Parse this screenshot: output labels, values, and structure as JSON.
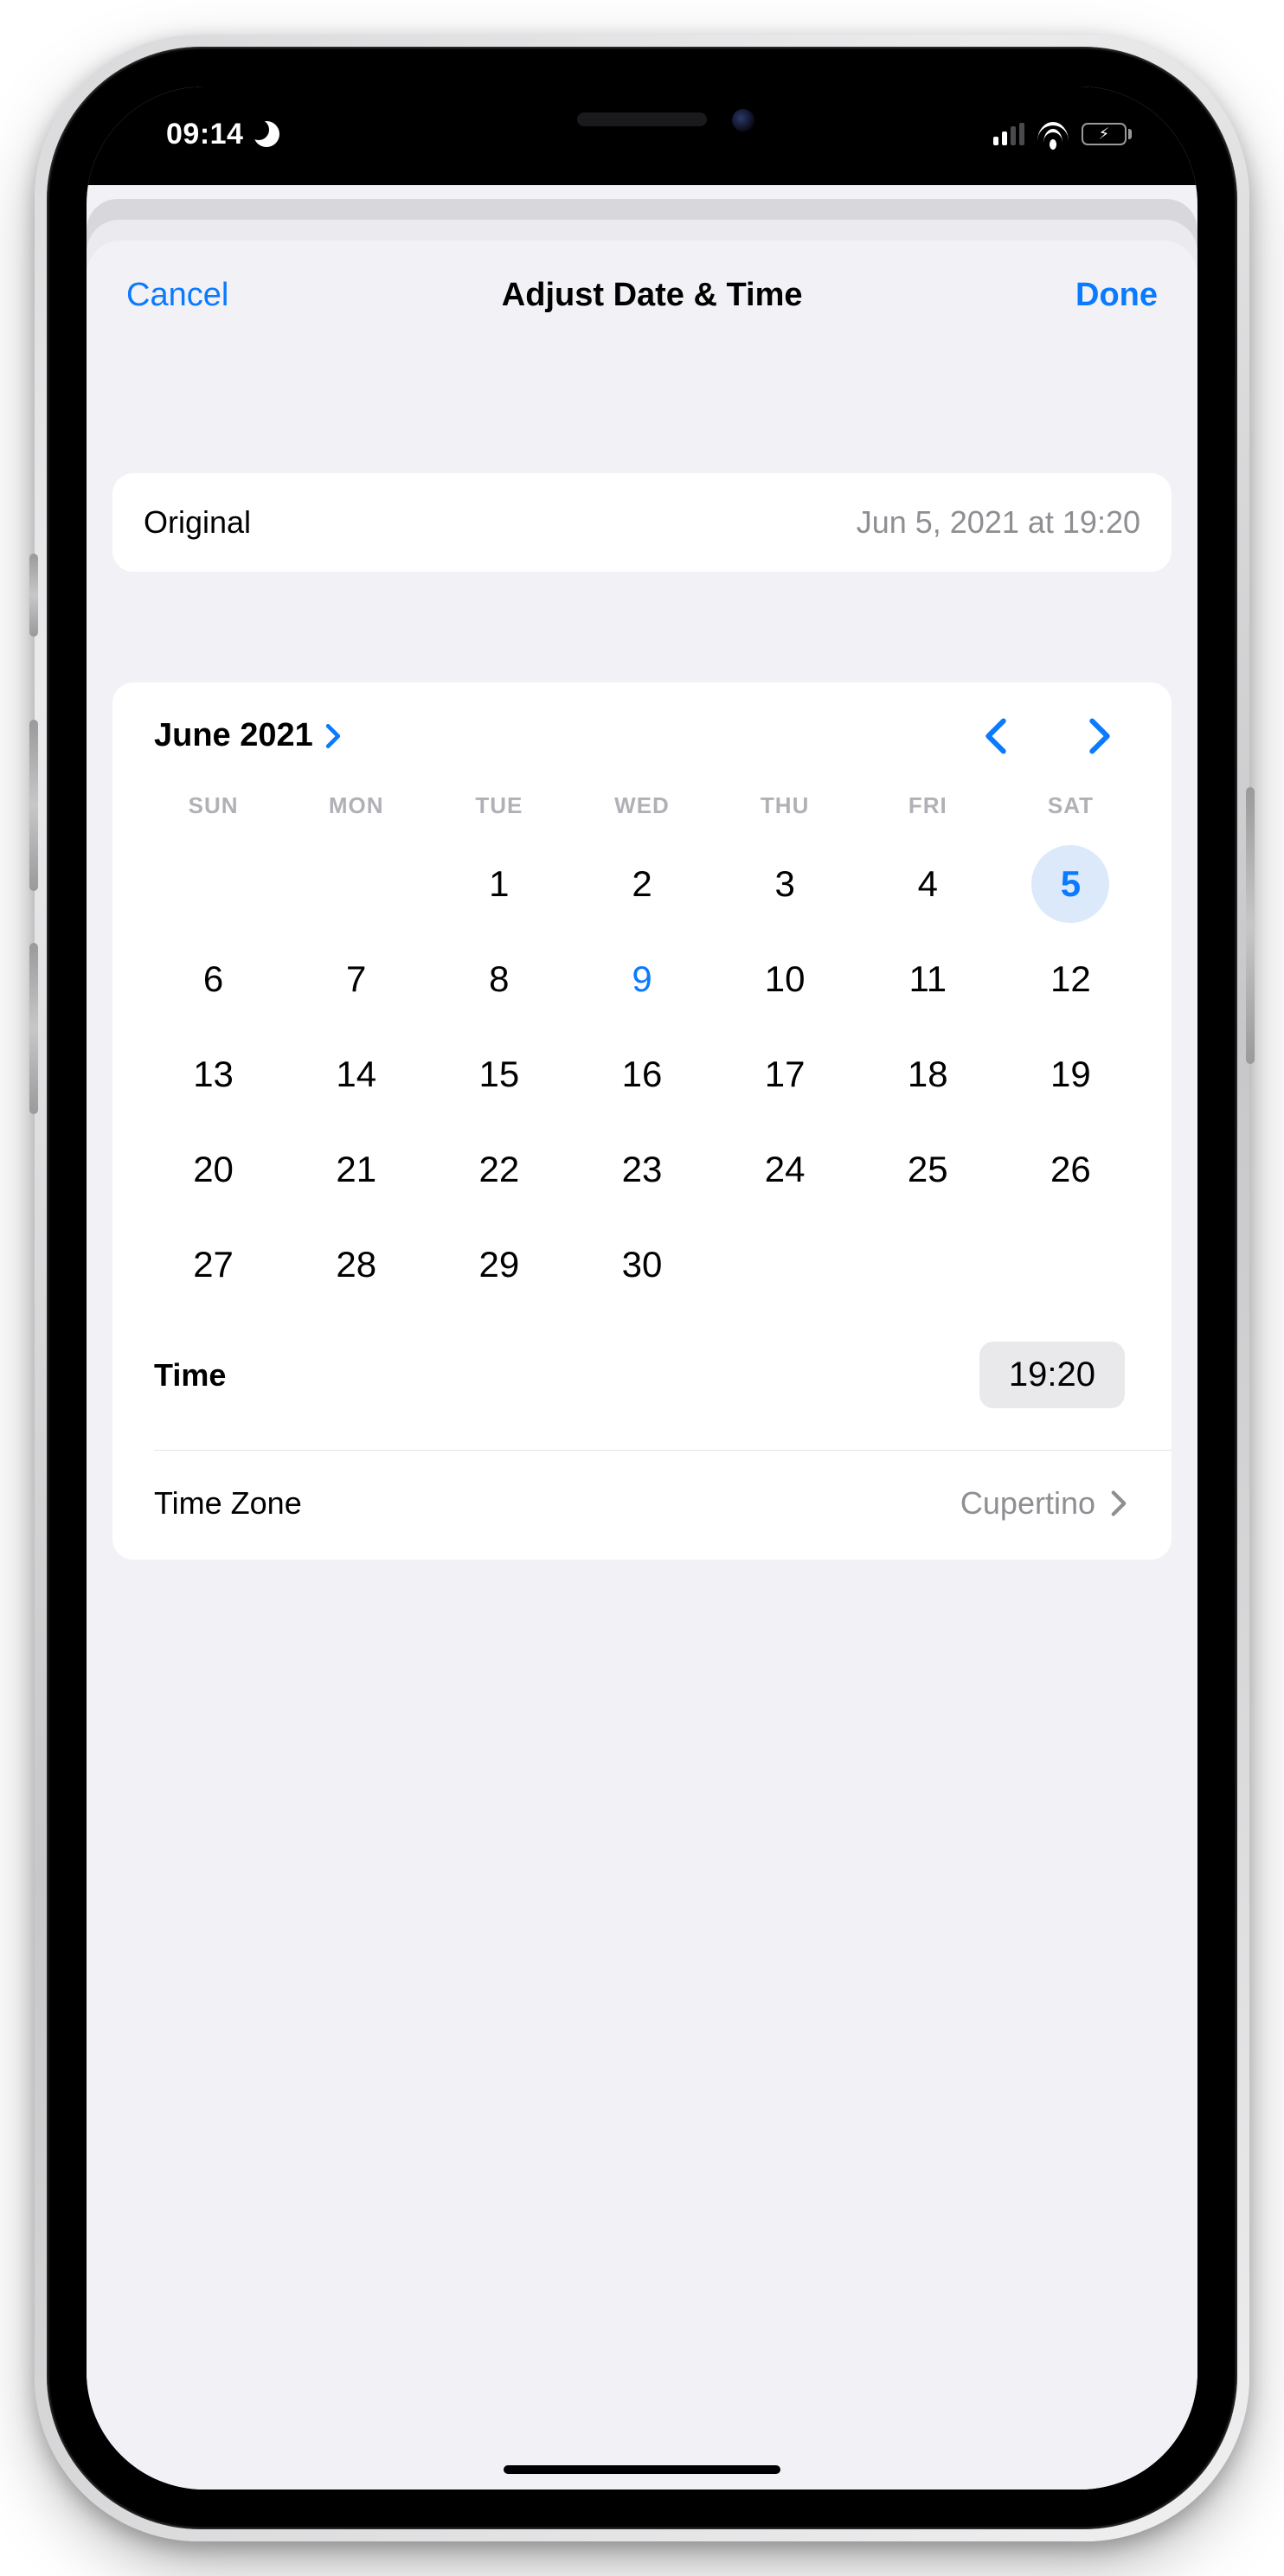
{
  "status_bar": {
    "time": "09:14",
    "dnd_icon": "moon-icon",
    "signal_bars_active": 2,
    "signal_bars_total": 4,
    "wifi": true,
    "battery": {
      "charging": true,
      "level_pct": 40,
      "color": "#33d158"
    }
  },
  "nav": {
    "cancel": "Cancel",
    "title": "Adjust Date & Time",
    "done": "Done"
  },
  "original": {
    "label": "Original",
    "value": "Jun 5, 2021 at 19:20"
  },
  "calendar": {
    "month_label": "June 2021",
    "weekdays": [
      "SUN",
      "MON",
      "TUE",
      "WED",
      "THU",
      "FRI",
      "SAT"
    ],
    "first_day_of_month_column": 2,
    "days_in_month": 30,
    "selected_day": 5,
    "today_marker_day": 9
  },
  "time": {
    "label": "Time",
    "value": "19:20"
  },
  "timezone": {
    "label": "Time Zone",
    "value": "Cupertino"
  },
  "colors": {
    "accent": "#0a7aff",
    "bg": "#f2f1f6",
    "card": "#ffffff",
    "grey": "#8e8e93"
  }
}
